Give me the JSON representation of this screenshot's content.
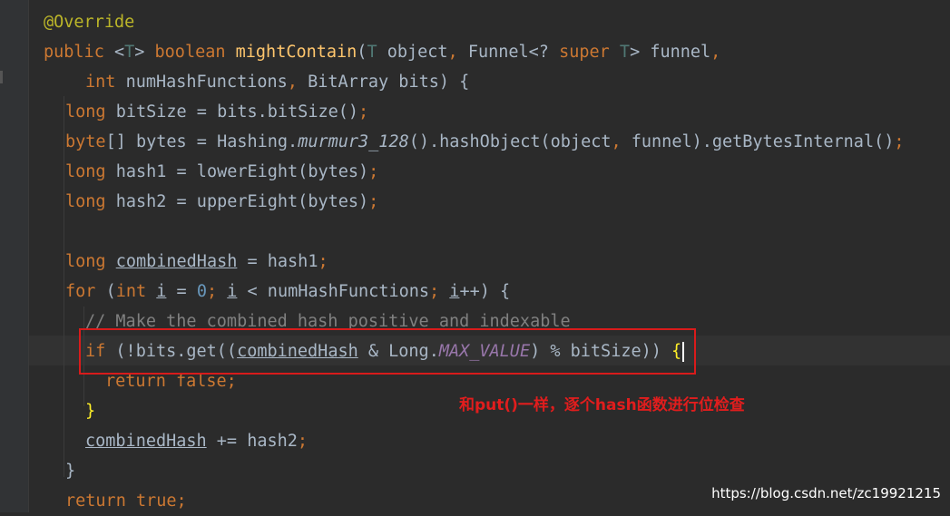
{
  "code": {
    "l1": {
      "annotation": "@Override"
    },
    "l2": {
      "public": "public",
      "lt": "<",
      "t1": "T",
      "gt": ">",
      "boolean": "boolean",
      "method": "mightContain",
      "open": "(",
      "t2": "T",
      "arg1": " object",
      "comma1": ",",
      "funnel": "Funnel<?",
      "super": "super",
      "t3": "T",
      "funnelEnd": "> funnel",
      "comma2": ","
    },
    "l3": {
      "int": "int",
      "rest": "numHashFunctions",
      "comma": ",",
      "rest2": "BitArray bits) {"
    },
    "l4": {
      "long": "long",
      "rest": "bitSize = bits.bitSize()",
      "semi": ";"
    },
    "l5": {
      "byte": "byte",
      "rest": "[] bytes = Hashing.",
      "murmur": "murmur3_128",
      "rest2": "().hashObject(object",
      "comma": ",",
      "rest3": "funnel).getBytesInternal()",
      "semi": ";"
    },
    "l6": {
      "long": "long",
      "rest": "hash1 = lowerEight(bytes)",
      "semi": ";"
    },
    "l7": {
      "long": "long",
      "rest": "hash2 = upperEight(bytes)",
      "semi": ";"
    },
    "l9": {
      "long": "long",
      "var": "combinedHash",
      "rest": " = hash1",
      "semi": ";"
    },
    "l10": {
      "for": "for",
      "open": "(",
      "int": "int",
      "i1": "i",
      "eq": " = ",
      "zero": "0",
      "semi1": ";",
      "i2": "i",
      "lt": " < numHashFunctions",
      "semi2": ";",
      "i3": "i",
      "end": "++) {"
    },
    "l11": {
      "comment": "// Make the combined hash positive and indexable"
    },
    "l12": {
      "if": "if",
      "rest": " (!bits.get((",
      "var": "combinedHash",
      "and": " & Long.",
      "const": "MAX_VALUE",
      "rest2": ") % bitSize))",
      "brace": "{"
    },
    "l13": {
      "return": "return",
      "false": "false",
      "semi": ";"
    },
    "l14": {
      "brace": "}"
    },
    "l15": {
      "var": "combinedHash",
      "rest": " += hash2",
      "semi": ";"
    },
    "l16": {
      "brace": "}"
    },
    "l17": {
      "return": "return",
      "true": "true",
      "semi": ";"
    }
  },
  "annotation_note": "和put()一样，逐个hash函数进行位检查",
  "watermark": "https://blog.csdn.net/zc19921215",
  "colors": {
    "background": "#2b2b2b",
    "keyword": "#cc7832",
    "text": "#a9b7c6",
    "method": "#ffc66d",
    "annotation": "#bbb529",
    "comment": "#808080",
    "number": "#6897bb",
    "constant": "#9876aa",
    "highlight_box": "#d91b1b"
  }
}
